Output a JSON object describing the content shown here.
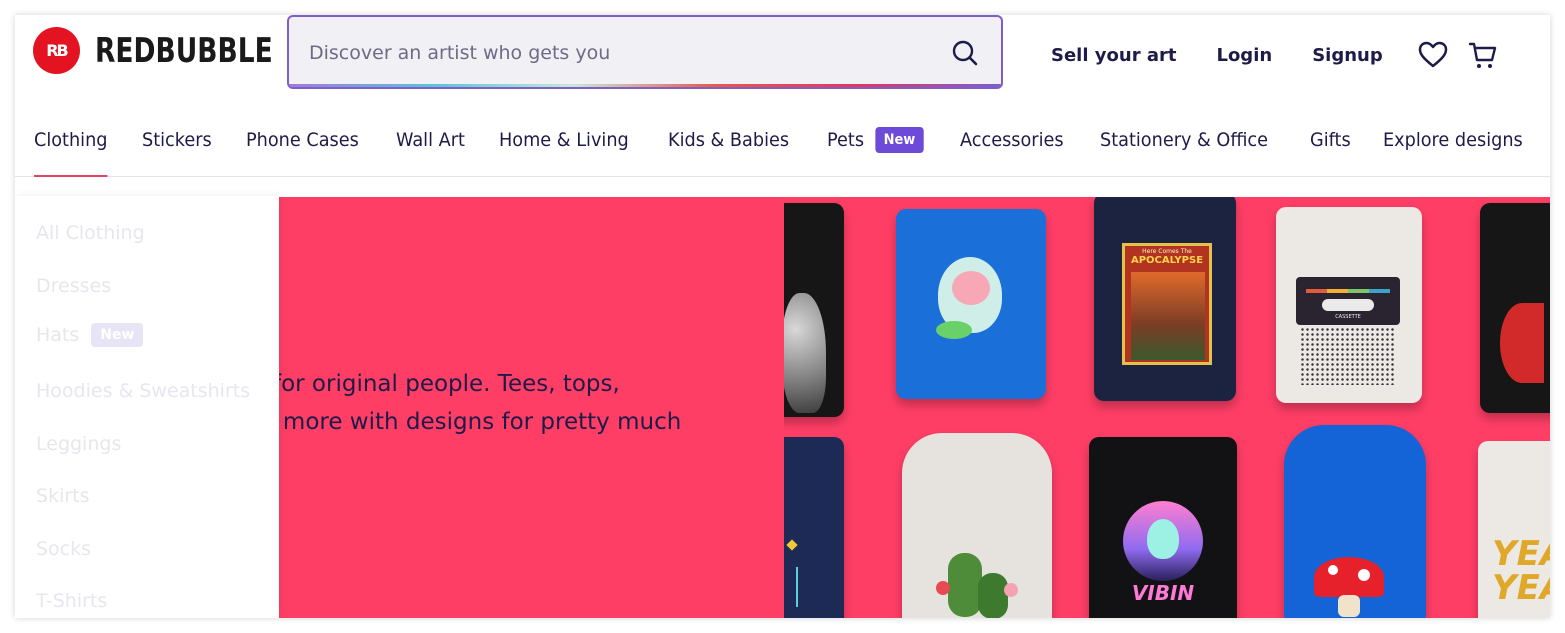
{
  "brand": {
    "logo_mark": "RB",
    "name": "REDBUBBLE",
    "color": "#e41321"
  },
  "search": {
    "placeholder": "Discover an artist who gets you",
    "icon": "search-icon"
  },
  "top_links": {
    "sell": "Sell your art",
    "login": "Login",
    "signup": "Signup",
    "wishlist_icon": "heart-icon",
    "cart_icon": "cart-icon"
  },
  "nav": {
    "items": [
      {
        "label": "Clothing",
        "active": true
      },
      {
        "label": "Stickers"
      },
      {
        "label": "Phone Cases"
      },
      {
        "label": "Wall Art"
      },
      {
        "label": "Home & Living"
      },
      {
        "label": "Kids & Babies"
      },
      {
        "label": "Pets",
        "badge": "New"
      },
      {
        "label": "Accessories"
      },
      {
        "label": "Stationery & Office"
      },
      {
        "label": "Gifts"
      },
      {
        "label": "Explore designs"
      }
    ],
    "accent": "#e44462",
    "badge_color": "#6e4ad9"
  },
  "dropdown": {
    "items": [
      {
        "label": "All Clothing"
      },
      {
        "label": "Dresses"
      },
      {
        "label": "Hats",
        "badge": "New"
      },
      {
        "label": "Hoodies & Sweatshirts"
      },
      {
        "label": "Leggings"
      },
      {
        "label": "Skirts"
      },
      {
        "label": "Socks"
      },
      {
        "label": "T-Shirts"
      }
    ]
  },
  "hero": {
    "line1": "for original people. Tees, tops,",
    "line2": "d more with designs for pretty much",
    "background": "#ff3e66",
    "photo_prints": {
      "apocalypse_top": "Here Comes The",
      "apocalypse_main": "APOCALYPSE",
      "cassette": "CASSETTE",
      "vibin": "VIBIN",
      "yea": "YEA"
    }
  }
}
